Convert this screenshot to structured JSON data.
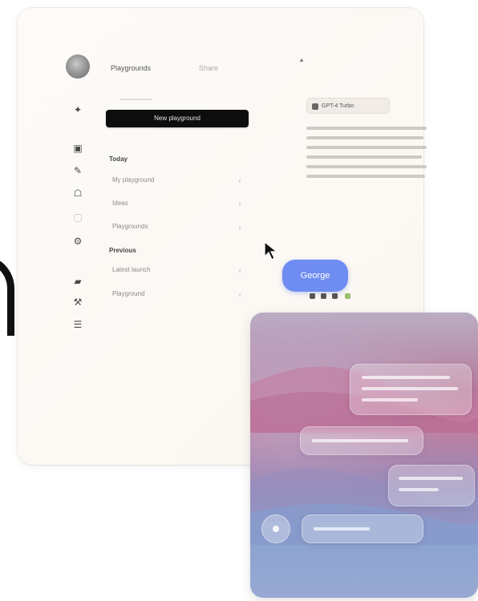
{
  "sidebar": {
    "title": "Playgrounds",
    "share": "Share",
    "new_button": "New playground",
    "section_1": "Today",
    "section_1_items": [
      "My playground",
      "Ideas",
      "Playgrounds"
    ],
    "section_2": "Previous",
    "section_2_items": [
      "Latest launch",
      "Playground"
    ]
  },
  "content": {
    "model_chip": "GPT-4 Turbo"
  },
  "bubble": {
    "label": "George"
  },
  "colors": {
    "bubble": "#6f8cf2",
    "new_button_bg": "#0d0d0d",
    "card_top": "#b9adc3",
    "card_mid": "#c07e9f",
    "card_bottom": "#97a9d2"
  }
}
